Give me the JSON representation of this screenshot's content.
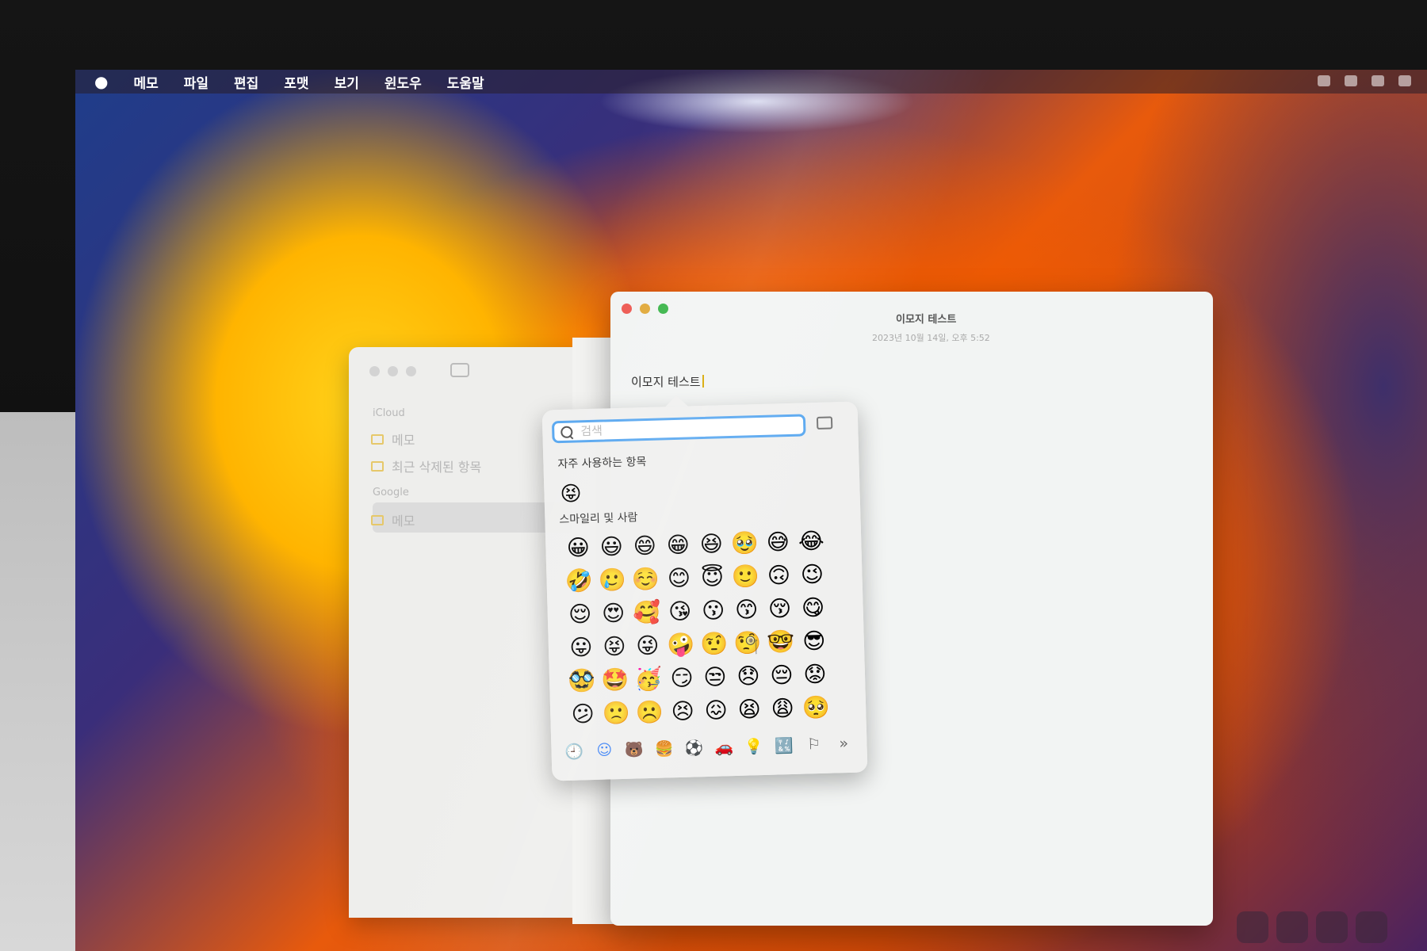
{
  "menubar": {
    "apple_icon": "apple-logo-icon",
    "items": [
      "메모",
      "파일",
      "편집",
      "포맷",
      "보기",
      "윈도우",
      "도움말"
    ]
  },
  "sidebar": {
    "section_icloud": "iCloud",
    "icloud_items": [
      "메모",
      "최근 삭제된 항목"
    ],
    "section_google": "Google",
    "google_items": [
      "메모"
    ]
  },
  "note": {
    "window_title": "이모지 테스트",
    "date": "2023년 10월 14일, 오후 5:52",
    "body_text": "이모지 테스트"
  },
  "emoji_picker": {
    "search_placeholder": "검색",
    "frequent_label": "자주 사용하는 항목",
    "frequent": [
      "😝"
    ],
    "smileys_label": "스마일리 및 사람",
    "smileys": [
      "😀",
      "😃",
      "😄",
      "😁",
      "😆",
      "🥹",
      "😅",
      "😂",
      "🤣",
      "🥲",
      "☺️",
      "😊",
      "😇",
      "🙂",
      "🙃",
      "😉",
      "😌",
      "😍",
      "🥰",
      "😘",
      "😗",
      "😙",
      "😚",
      "😋",
      "😛",
      "😝",
      "😜",
      "🤪",
      "🤨",
      "🧐",
      "🤓",
      "😎",
      "🥸",
      "🤩",
      "🥳",
      "😏",
      "😒",
      "😞",
      "😔",
      "😟",
      "😕",
      "🙁",
      "☹️",
      "😣",
      "😖",
      "😫",
      "😩",
      "🥺"
    ],
    "categories": [
      "🕘",
      "☺",
      "🐻",
      "🍔",
      "⚽",
      "🚗",
      "💡",
      "🔣",
      "⚐",
      "»"
    ],
    "active_category_index": 1,
    "colors": {
      "accent": "#5aa8f0",
      "active_category": "#3b82f6"
    }
  }
}
